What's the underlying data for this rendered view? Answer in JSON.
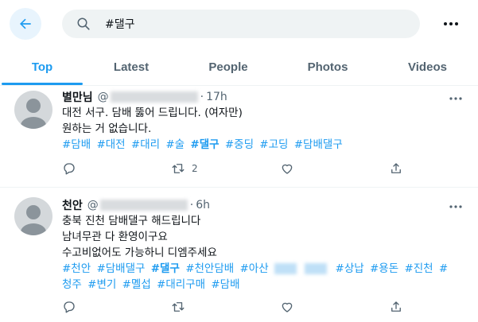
{
  "search": {
    "query": "#댈구"
  },
  "tabs": [
    {
      "label": "Top",
      "active": true
    },
    {
      "label": "Latest",
      "active": false
    },
    {
      "label": "People",
      "active": false
    },
    {
      "label": "Photos",
      "active": false
    },
    {
      "label": "Videos",
      "active": false
    }
  ],
  "tweets": [
    {
      "name": "별만님",
      "handle": "@",
      "time": "17h",
      "lines": [
        "대전 서구. 담배 뚫어 드립니다. (여자만)",
        "원하는 거 없습니다."
      ],
      "hashtags": [
        "#담배",
        "#대전",
        "#대리",
        "#술",
        "#댈구",
        "#중딩",
        "#고딩",
        "#담배댈구"
      ],
      "reply_count": "",
      "retweet_count": "2",
      "like_count": ""
    },
    {
      "name": "천안",
      "handle": "@",
      "time": "6h",
      "lines": [
        "충북 진천 담배댈구 해드립니다",
        "남녀무관 다 환영이구요",
        "수고비없어도 가능하니 디엠주세요"
      ],
      "hashtags": [
        "#천안",
        "#담배댈구",
        "#댈구",
        "#천안담배",
        "#아산",
        "#상납",
        "#용돈",
        "#진천",
        "#청주",
        "#변기",
        "#몔섭",
        "#대리구매",
        "#담배"
      ],
      "reply_count": "",
      "retweet_count": "",
      "like_count": ""
    }
  ],
  "colors": {
    "accent": "#1d9bf0",
    "secondary_text": "#536471",
    "divider": "#eff3f4"
  }
}
